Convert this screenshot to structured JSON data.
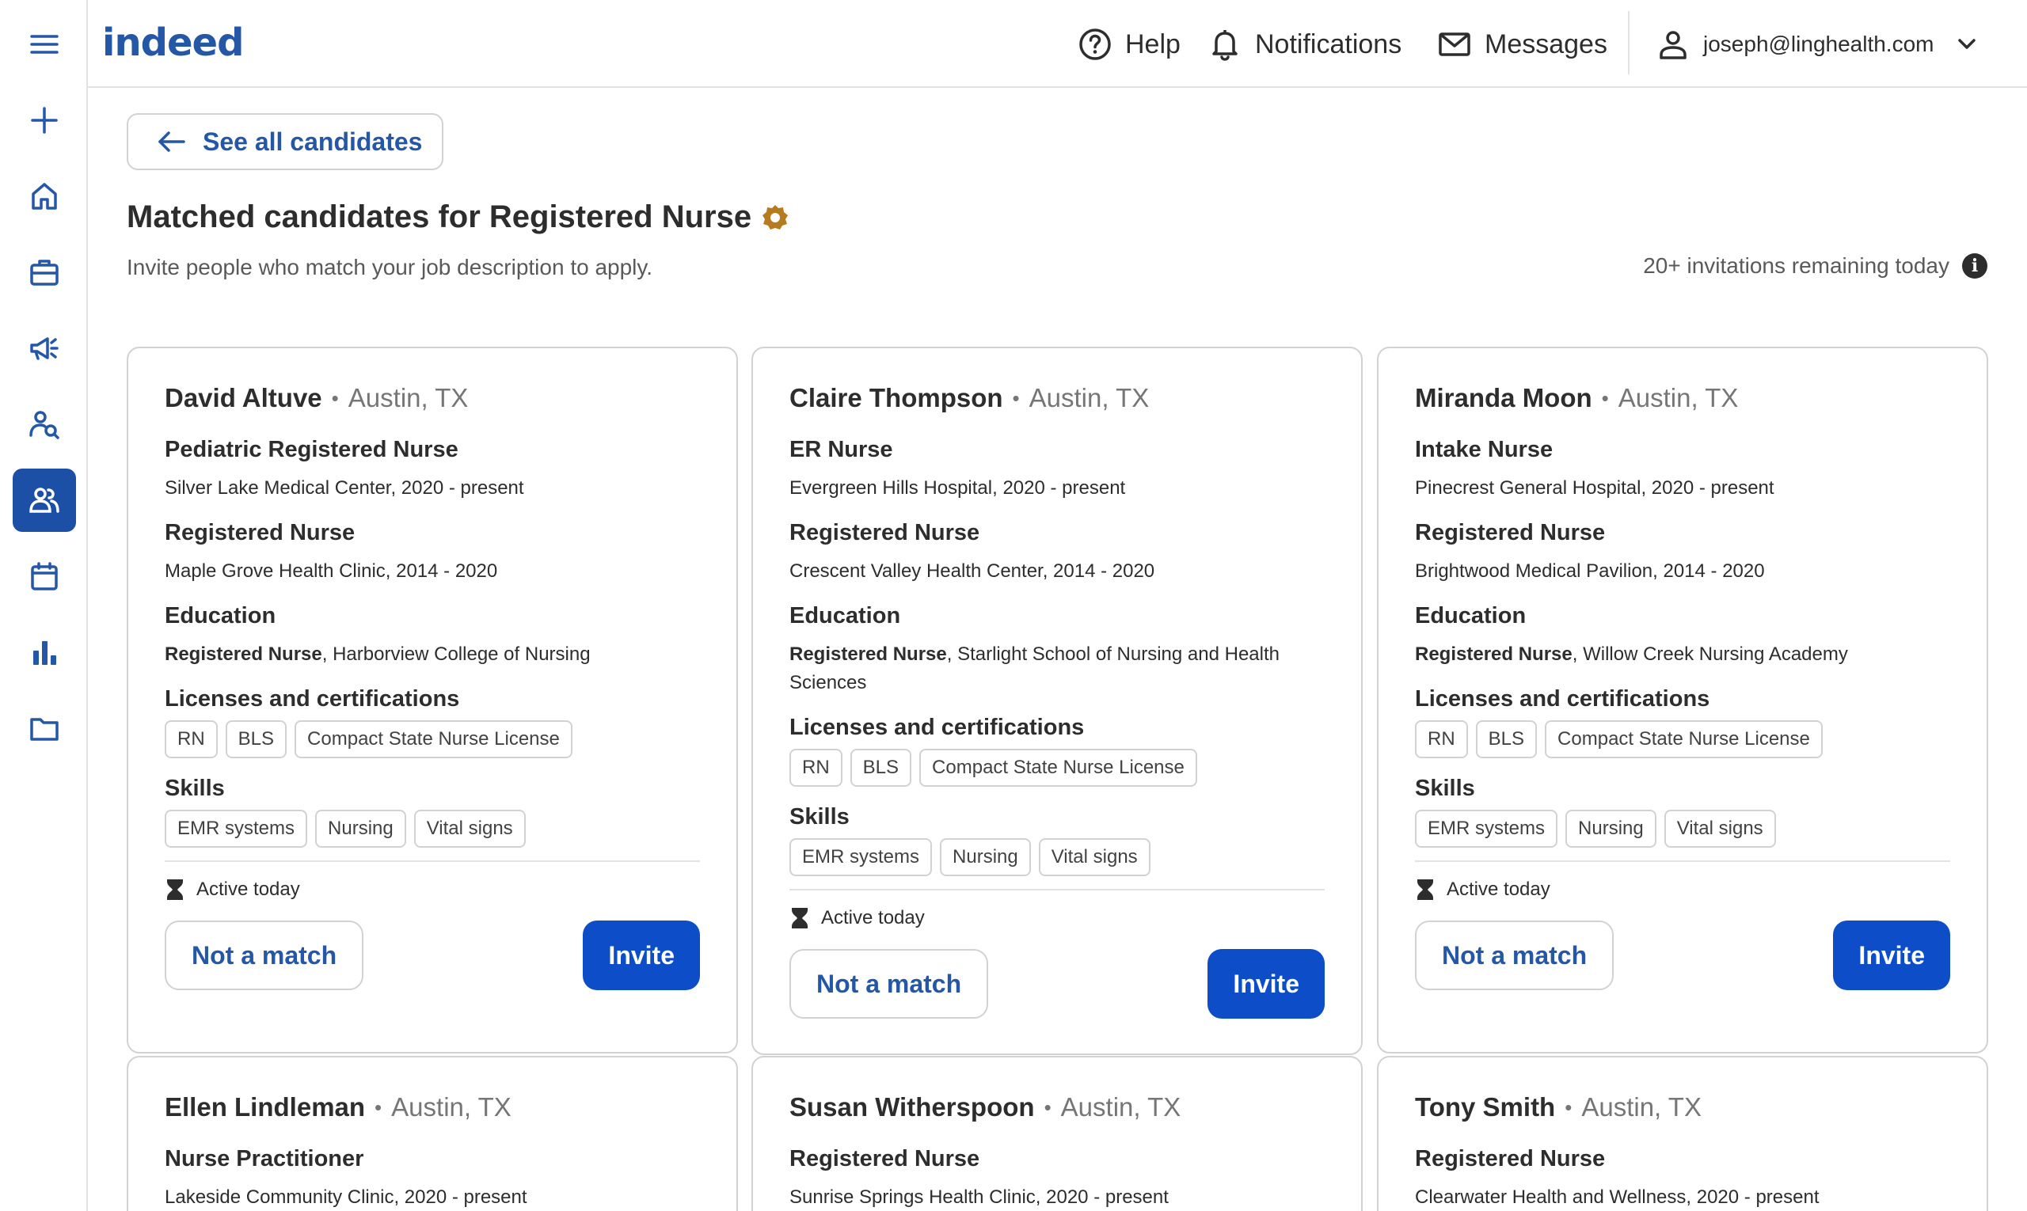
{
  "header": {
    "logo": "indeed",
    "help": "Help",
    "notifications": "Notifications",
    "messages": "Messages",
    "account": "joseph@linghealth.com"
  },
  "sidebar": {
    "items": [
      {
        "icon": "menu-icon"
      },
      {
        "icon": "plus-icon"
      },
      {
        "icon": "home-icon"
      },
      {
        "icon": "briefcase-icon"
      },
      {
        "icon": "megaphone-icon"
      },
      {
        "icon": "search-person-icon"
      },
      {
        "icon": "candidates-icon",
        "active": true
      },
      {
        "icon": "calendar-icon"
      },
      {
        "icon": "analytics-icon"
      },
      {
        "icon": "folder-icon"
      }
    ]
  },
  "main": {
    "back": "See all candidates",
    "title": "Matched candidates for Registered Nurse",
    "subtitle": "Invite people who match your job description to apply.",
    "remaining": "20+ invitations remaining today"
  },
  "labels": {
    "education": "Education",
    "licenses": "Licenses and certifications",
    "skills": "Skills",
    "active": "Active today",
    "not_match": "Not a match",
    "invite": "Invite"
  },
  "candidates": [
    {
      "name": "David Altuve",
      "location": "Austin, TX",
      "job1": "Pediatric Registered Nurse",
      "job1_sub": "Silver Lake Medical Center, 2020 - present",
      "job2": "Registered Nurse",
      "job2_sub": "Maple Grove Health Clinic, 2014 - 2020",
      "edu_degree": "Registered Nurse",
      "edu_school": ", Harborview College of Nursing",
      "licenses": [
        "RN",
        "BLS",
        "Compact State Nurse License"
      ],
      "skills": [
        "EMR systems",
        "Nursing",
        "Vital signs"
      ]
    },
    {
      "name": "Claire Thompson",
      "location": "Austin, TX",
      "job1": "ER Nurse",
      "job1_sub": "Evergreen Hills Hospital, 2020 - present",
      "job2": "Registered Nurse",
      "job2_sub": "Crescent Valley Health Center, 2014 - 2020",
      "edu_degree": "Registered Nurse",
      "edu_school": ", Starlight School of Nursing and Health Sciences",
      "licenses": [
        "RN",
        "BLS",
        "Compact State Nurse License"
      ],
      "skills": [
        "EMR systems",
        "Nursing",
        "Vital signs"
      ]
    },
    {
      "name": "Miranda Moon",
      "location": "Austin, TX",
      "job1": "Intake Nurse",
      "job1_sub": "Pinecrest General Hospital, 2020 - present",
      "job2": "Registered Nurse",
      "job2_sub": "Brightwood Medical Pavilion, 2014 - 2020",
      "edu_degree": "Registered Nurse",
      "edu_school": ", Willow Creek Nursing Academy",
      "licenses": [
        "RN",
        "BLS",
        "Compact State Nurse License"
      ],
      "skills": [
        "EMR systems",
        "Nursing",
        "Vital signs"
      ]
    },
    {
      "name": "Ellen Lindleman",
      "location": "Austin, TX",
      "job1": "Nurse Practitioner",
      "job1_sub": "Lakeside Community Clinic, 2020 - present"
    },
    {
      "name": "Susan Witherspoon",
      "location": "Austin, TX",
      "job1": "Registered Nurse",
      "job1_sub": "Sunrise Springs Health Clinic, 2020 - present"
    },
    {
      "name": "Tony Smith",
      "location": "Austin, TX",
      "job1": "Registered Nurse",
      "job1_sub": "Clearwater Health and Wellness, 2020 - present"
    }
  ]
}
